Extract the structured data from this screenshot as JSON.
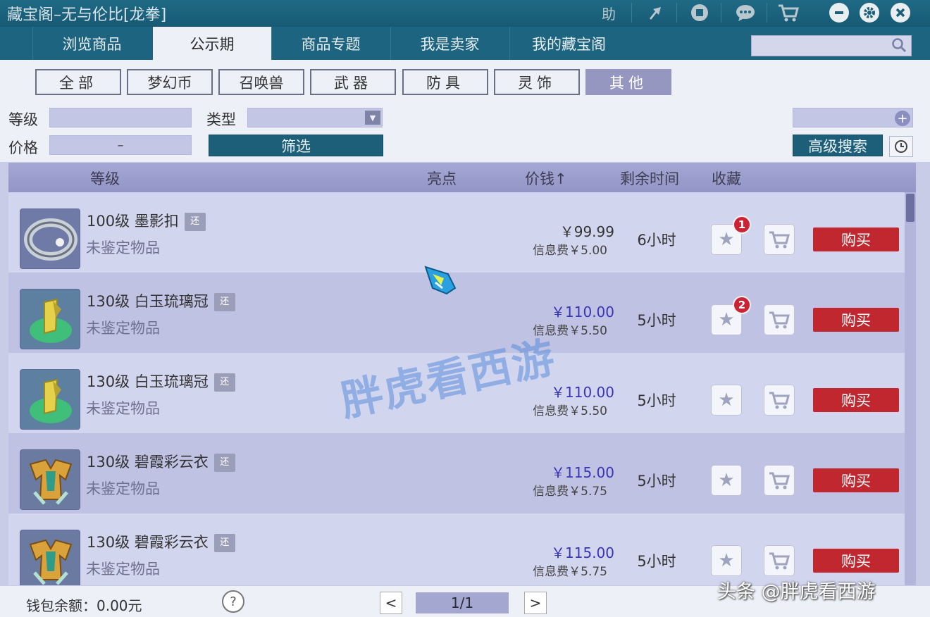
{
  "window": {
    "title": "藏宝阁–无与伦比[龙拳]",
    "help_label": "助"
  },
  "tabs": [
    {
      "label": "浏览商品"
    },
    {
      "label": "公示期"
    },
    {
      "label": "商品专题"
    },
    {
      "label": "我是卖家"
    },
    {
      "label": "我的藏宝阁"
    }
  ],
  "search": {
    "placeholder": ""
  },
  "categories": [
    {
      "label": "全部"
    },
    {
      "label": "梦幻币"
    },
    {
      "label": "召唤兽"
    },
    {
      "label": "武器"
    },
    {
      "label": "防具"
    },
    {
      "label": "灵饰"
    },
    {
      "label": "其他"
    }
  ],
  "filters": {
    "level_label": "等级",
    "type_label": "类型",
    "price_label": "价格",
    "price_separator": "–",
    "filter_button": "筛选",
    "advanced_search": "高级搜索"
  },
  "table": {
    "headers": {
      "level": "等级",
      "highlight": "亮点",
      "price": "价钱↑",
      "remaining": "剩余时间",
      "favorite": "收藏"
    },
    "rows": [
      {
        "name": "100级 墨影扣",
        "tag": "还",
        "status": "未鉴定物品",
        "price": "￥99.99",
        "fee": "信息费￥5.00",
        "time": "6小时",
        "badge": "1",
        "buy": "购买",
        "icon": "ring-icon"
      },
      {
        "name": "130级 白玉琉璃冠",
        "tag": "还",
        "status": "未鉴定物品",
        "price": "￥110.00",
        "fee": "信息费￥5.50",
        "time": "5小时",
        "badge": "2",
        "buy": "购买",
        "icon": "crown-icon"
      },
      {
        "name": "130级 白玉琉璃冠",
        "tag": "还",
        "status": "未鉴定物品",
        "price": "￥110.00",
        "fee": "信息费￥5.50",
        "time": "5小时",
        "badge": "",
        "buy": "购买",
        "icon": "crown-icon"
      },
      {
        "name": "130级 碧霞彩云衣",
        "tag": "还",
        "status": "未鉴定物品",
        "price": "￥115.00",
        "fee": "信息费￥5.75",
        "time": "5小时",
        "badge": "",
        "buy": "购买",
        "icon": "robe-icon"
      },
      {
        "name": "130级 碧霞彩云衣",
        "tag": "还",
        "status": "未鉴定物品",
        "price": "￥115.00",
        "fee": "信息费￥5.75",
        "time": "5小时",
        "badge": "",
        "buy": "购买",
        "icon": "robe-icon"
      }
    ]
  },
  "footer": {
    "wallet": "钱包余额：0.00元",
    "help": "?",
    "prev": "<",
    "next": ">",
    "page": "1/1"
  },
  "watermarks": {
    "center": "胖虎看西游",
    "credit": "头条 @胖虎看西游"
  },
  "colors": {
    "titlebar": "#1d6480",
    "buy_button": "#c0272f",
    "price_blue": "#3a34b8",
    "badge_red": "#cc2233"
  }
}
